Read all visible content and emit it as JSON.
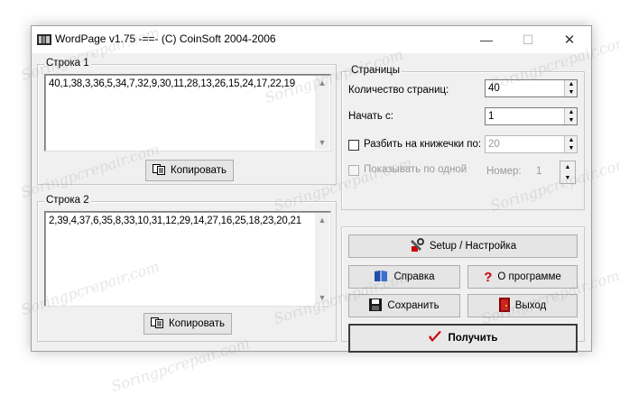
{
  "window": {
    "title": "WordPage v1.75 -==- (C) CoinSoft 2004-2006",
    "minimize": "—",
    "maximize": "☐",
    "close": "✕"
  },
  "row1": {
    "legend": "Строка 1",
    "text": "40,1,38,3,36,5,34,7,32,9,30,11,28,13,26,15,24,17,22,19",
    "copy_label": "Копировать"
  },
  "row2": {
    "legend": "Строка 2",
    "text": "2,39,4,37,6,35,8,33,10,31,12,29,14,27,16,25,18,23,20,21",
    "copy_label": "Копировать"
  },
  "pages": {
    "legend": "Страницы",
    "count_label": "Количество страниц:",
    "count_value": "40",
    "start_label": "Начать с:",
    "start_value": "1",
    "split_label": "Разбить на книжечки по:",
    "split_value": "20",
    "show_one_label": "Показывать по одной",
    "number_label": "Номер:",
    "number_value": "1"
  },
  "actions": {
    "setup_label": "Setup / Настройка",
    "help_label": "Справка",
    "about_label": "О программе",
    "save_label": "Сохранить",
    "exit_label": "Выход",
    "get_label": "Получить"
  },
  "watermark": "Soringpcrepair.com",
  "colors": {
    "window_bg": "#f0f0f0",
    "check_red": "#cc0000",
    "book_blue": "#1f4fa8"
  }
}
